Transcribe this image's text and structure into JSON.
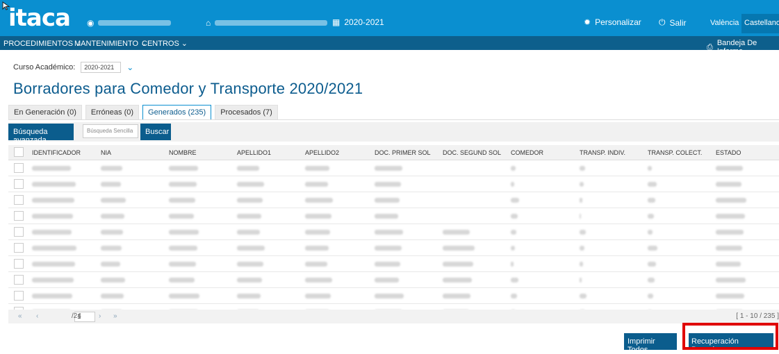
{
  "app": {
    "logo": "itaca",
    "user_name": "",
    "centre_name": "",
    "academic_year": "2020-2021"
  },
  "header": {
    "customize_label": "Personalizar",
    "exit_label": "Salir",
    "lang_valencia": "València",
    "lang_castellano": "Castellano"
  },
  "menu": {
    "items": [
      "PROCEDIMIENTOS",
      "MANTENIMIENTO",
      "CENTROS"
    ],
    "tray_label": "Bandeja De Informe"
  },
  "course": {
    "label": "Curso Académico:",
    "value": "2020-2021"
  },
  "page_title": "Borradores para Comedor y Transporte 2020/2021",
  "tabs": [
    {
      "label": "En Generación (0)"
    },
    {
      "label": "Erróneas (0)"
    },
    {
      "label": "Generados (235)",
      "active": true
    },
    {
      "label": "Procesados (7)"
    }
  ],
  "toolbar": {
    "advanced_search": "Búsqueda avanzada",
    "search_placeholder": "Búsqueda Sencilla",
    "search_button": "Buscar"
  },
  "table": {
    "columns": [
      "IDENTIFICADOR",
      "NIA",
      "NOMBRE",
      "APELLIDO1",
      "APELLIDO2",
      "DOC. PRIMER SOL",
      "DOC. SEGUND SOL",
      "COMEDOR",
      "TRANSP. INDIV.",
      "TRANSP. COLECT.",
      "ESTADO"
    ],
    "row_count": 10
  },
  "pager": {
    "first": "«",
    "prev": "‹",
    "page": "1",
    "total": "/24",
    "next": "›",
    "last": "»",
    "range": "[ 1 - 10 / 235 ]"
  },
  "actions": {
    "print_all": "Imprimir Todos",
    "recover_drafts": "Recuperación Borradores"
  },
  "colors": {
    "header_blue": "#0a8fd0",
    "menu_blue": "#0d5f8c",
    "button_blue": "#0b5d8d",
    "highlight_red": "#e00000"
  }
}
